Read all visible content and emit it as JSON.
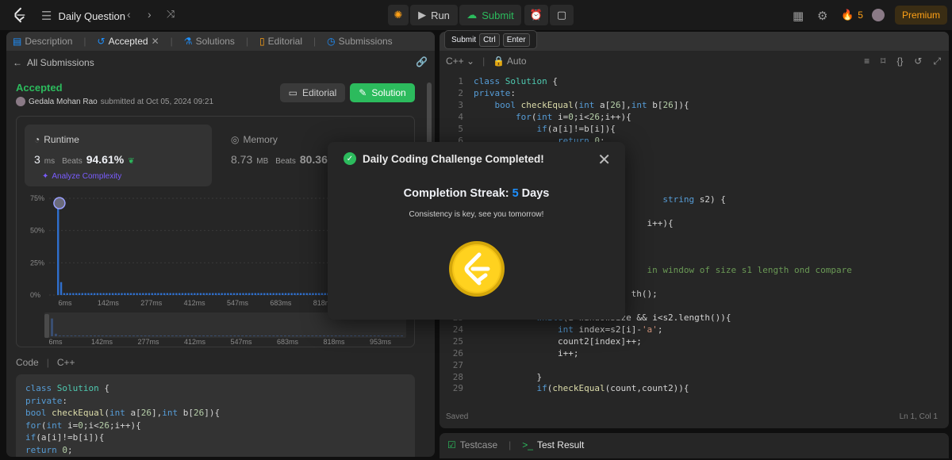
{
  "topbar": {
    "title": "Daily Question",
    "run_label": "Run",
    "submit_label": "Submit",
    "streak_count": "5",
    "premium_label": "Premium"
  },
  "tooltip": {
    "label": "Submit",
    "key1": "Ctrl",
    "key2": "Enter"
  },
  "left": {
    "tabs": [
      {
        "label": "Description"
      },
      {
        "label": "Accepted"
      },
      {
        "label": "Solutions"
      },
      {
        "label": "Editorial"
      },
      {
        "label": "Submissions"
      }
    ],
    "all_submissions": "All Submissions",
    "status": "Accepted",
    "author": "Gedala Mohan Rao",
    "submitted_text": "submitted at Oct 05, 2024 09:21",
    "editorial_btn": "Editorial",
    "solution_btn": "Solution",
    "runtime": {
      "title": "Runtime",
      "value": "3",
      "unit": "ms",
      "beats_label": "Beats",
      "beats": "94.61%"
    },
    "memory": {
      "title": "Memory",
      "value": "8.73",
      "unit": "MB",
      "beats_label": "Beats",
      "beats": "80.36%"
    },
    "analyze": "Analyze Complexity",
    "code_label": "Code",
    "lang_label": "C++"
  },
  "chart_data": {
    "type": "bar",
    "y_ticks": [
      "75%",
      "50%",
      "25%",
      "0%"
    ],
    "ylim": [
      0,
      75
    ],
    "x_ticks": [
      "6ms",
      "142ms",
      "277ms",
      "412ms",
      "547ms",
      "683ms",
      "818ms"
    ],
    "mini_x_ticks": [
      "6ms",
      "142ms",
      "277ms",
      "412ms",
      "547ms",
      "683ms",
      "818ms",
      "953ms"
    ],
    "values": [
      70,
      10,
      1.5,
      1.5,
      1.5,
      1.5,
      1.5,
      1.5,
      1.5,
      1.5,
      1.5,
      1.5,
      1.5,
      1.5,
      1.5,
      1.5,
      1.5,
      1.5,
      1.5,
      1.5,
      1.5,
      1.5,
      1.5,
      1.5,
      1.5,
      1.5,
      1.5,
      1.5,
      1.5,
      1.5,
      1.5,
      1.5,
      1.5,
      1.5,
      1.5,
      1.5,
      1.5,
      1.5,
      1.5,
      1.5,
      1.5,
      1.5,
      1.5,
      1.5,
      1.5,
      1.5,
      1.5,
      1.5,
      1.5,
      1.5,
      1.5,
      1.5,
      1.5,
      1.5,
      1.5,
      1.5,
      1.5,
      1.5,
      1.5,
      1.5,
      1.5,
      1.5,
      1.5,
      1.5,
      1.5,
      1.5,
      1.5,
      1.5,
      1.5,
      1.5,
      1.5,
      1.5,
      1.5,
      1.5,
      1.5,
      1.5,
      1.5,
      1.5,
      1.5,
      1.5,
      1.5,
      1.5,
      1.5,
      1.5,
      1.5,
      1.5,
      1.5,
      1.5,
      1.5,
      1.5,
      1.5
    ],
    "bar_color": "#2f6fcc"
  },
  "left_code": [
    "class Solution {",
    "private:",
    "    bool checkEqual(int a[26],int b[26]){",
    "        for(int i=0;i<26;i++){",
    "            if(a[i]!=b[i]){",
    "                return 0;"
  ],
  "editor": {
    "lang": "C++",
    "auto": "Auto",
    "saved": "Saved",
    "cursor": "Ln 1, Col 1",
    "lines": [
      {
        "n": "1",
        "t": "class Solution {"
      },
      {
        "n": "2",
        "t": "private:"
      },
      {
        "n": "3",
        "t": "    bool checkEqual(int a[26],int b[26]){"
      },
      {
        "n": "4",
        "t": "        for(int i=0;i<26;i++){"
      },
      {
        "n": "5",
        "t": "            if(a[i]!=b[i]){"
      },
      {
        "n": "6",
        "t": "                return 0;"
      },
      {
        "n": "",
        "t": ""
      },
      {
        "n": "",
        "t": ""
      },
      {
        "n": "",
        "t": ""
      },
      {
        "n": "",
        "t": ""
      },
      {
        "n": "",
        "t": "                                    string s2) {"
      },
      {
        "n": "",
        "t": ""
      },
      {
        "n": "",
        "t": "                                 i++){"
      },
      {
        "n": "",
        "t": ""
      },
      {
        "n": "",
        "t": ""
      },
      {
        "n": "",
        "t": ""
      },
      {
        "n": "",
        "t": "                                 in window of size s1 length ond compare"
      },
      {
        "n": "",
        "t": ""
      },
      {
        "n": "",
        "t": "                              th();"
      },
      {
        "n": "",
        "t": ""
      },
      {
        "n": "23",
        "t": "            while(i<windowSize && i<s2.length()){"
      },
      {
        "n": "24",
        "t": "                int index=s2[i]-'a';"
      },
      {
        "n": "25",
        "t": "                count2[index]++;"
      },
      {
        "n": "26",
        "t": "                i++;"
      },
      {
        "n": "27",
        "t": ""
      },
      {
        "n": "28",
        "t": "            }"
      },
      {
        "n": "29",
        "t": "            if(checkEqual(count,count2)){"
      }
    ]
  },
  "bottom": {
    "testcase": "Testcase",
    "result": "Test Result"
  },
  "modal": {
    "title": "Daily Coding Challenge Completed!",
    "streak_label": "Completion Streak:",
    "streak_value": "5",
    "streak_unit": "Days",
    "subtitle": "Consistency is key, see you tomorrow!"
  }
}
